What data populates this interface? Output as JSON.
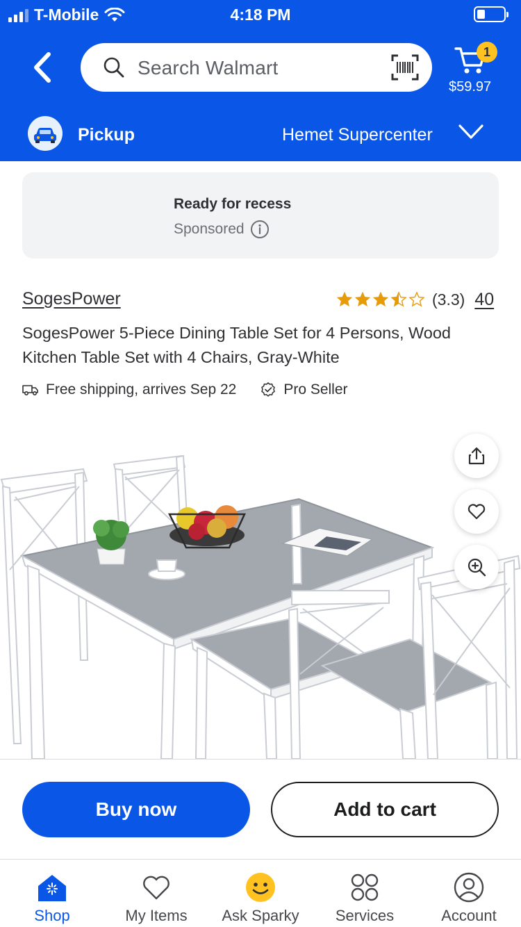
{
  "status_bar": {
    "carrier": "T-Mobile",
    "time": "4:18 PM"
  },
  "header": {
    "search_placeholder": "Search Walmart",
    "cart_count": "1",
    "cart_total": "$59.97",
    "pickup_label": "Pickup",
    "store_name": "Hemet Supercenter"
  },
  "sponsored": {
    "title": "Ready for recess",
    "label": "Sponsored"
  },
  "product": {
    "brand": "SogesPower",
    "rating_stars": 3.3,
    "rating_text": "(3.3)",
    "review_count": "40",
    "title": "SogesPower 5-Piece Dining Table Set for 4 Persons, Wood Kitchen Table Set with 4 Chairs, Gray-White",
    "shipping": "Free shipping, arrives Sep 22",
    "seller_badge": "Pro Seller"
  },
  "actions": {
    "buy_now": "Buy now",
    "add_to_cart": "Add to cart"
  },
  "nav": {
    "items": [
      {
        "label": "Shop",
        "icon": "shop-icon",
        "active": true
      },
      {
        "label": "My Items",
        "icon": "heart-icon",
        "active": false
      },
      {
        "label": "Ask Sparky",
        "icon": "sparky-icon",
        "active": false
      },
      {
        "label": "Services",
        "icon": "services-icon",
        "active": false
      },
      {
        "label": "Account",
        "icon": "account-icon",
        "active": false
      }
    ]
  },
  "colors": {
    "brand_blue": "#0a56e6",
    "spark_yellow": "#ffc220",
    "star_orange": "#e59b0a"
  }
}
